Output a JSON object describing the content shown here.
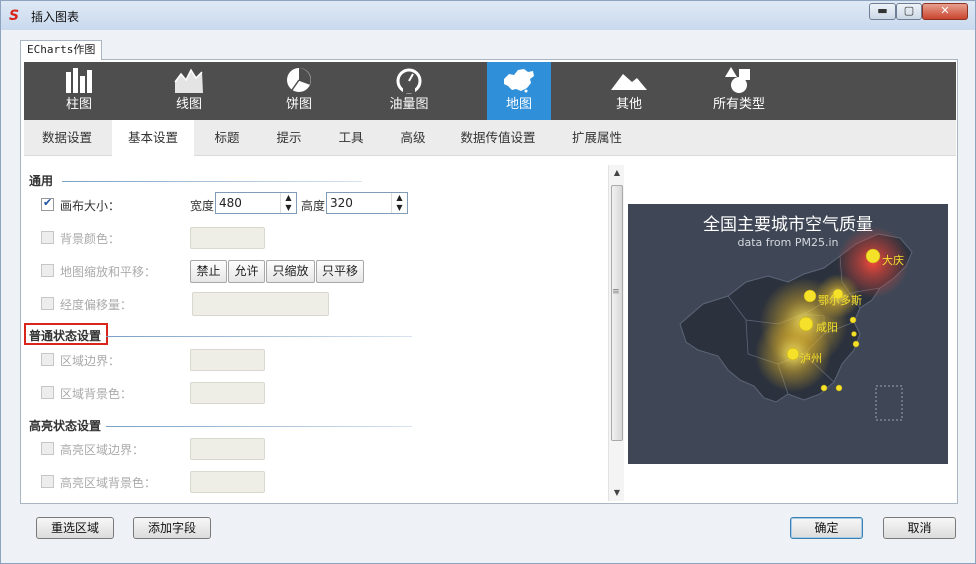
{
  "window": {
    "title": "插入图表",
    "app_icon": "S"
  },
  "tab": {
    "label": "ECharts作图"
  },
  "chart_types": [
    {
      "label": "柱图",
      "icon": "bar-chart-icon",
      "active": false
    },
    {
      "label": "线图",
      "icon": "line-chart-icon",
      "active": false
    },
    {
      "label": "饼图",
      "icon": "pie-chart-icon",
      "active": false
    },
    {
      "label": "油量图",
      "icon": "gauge-icon",
      "active": false
    },
    {
      "label": "地图",
      "icon": "china-map-icon",
      "active": true
    },
    {
      "label": "其他",
      "icon": "mountain-icon",
      "active": false
    },
    {
      "label": "所有类型",
      "icon": "shapes-icon",
      "active": false
    }
  ],
  "sub_tabs": [
    {
      "label": "数据设置",
      "active": false
    },
    {
      "label": "基本设置",
      "active": true
    },
    {
      "label": "标题",
      "active": false
    },
    {
      "label": "提示",
      "active": false
    },
    {
      "label": "工具",
      "active": false
    },
    {
      "label": "高级",
      "active": false
    },
    {
      "label": "数据传值设置",
      "active": false
    },
    {
      "label": "扩展属性",
      "active": false
    }
  ],
  "sections": {
    "general": {
      "title": "通用",
      "canvas_size": {
        "label": "画布大小：",
        "checked": true,
        "width_label": "宽度",
        "width_value": "480",
        "height_label": "高度",
        "height_value": "320"
      },
      "bg_color": {
        "label": "背景颜色："
      },
      "zoom_pan": {
        "label": "地图缩放和平移：",
        "options": [
          "禁止",
          "允许",
          "只缩放",
          "只平移"
        ]
      },
      "lon_offset": {
        "label": "经度偏移量："
      }
    },
    "normal_state": {
      "title": "普通状态设置",
      "region_border": {
        "label": "区域边界："
      },
      "region_bg": {
        "label": "区域背景色："
      }
    },
    "highlight_state": {
      "title": "高亮状态设置",
      "hl_border": {
        "label": "高亮区域边界："
      },
      "hl_bg": {
        "label": "高亮区域背景色："
      }
    }
  },
  "preview": {
    "title": "全国主要城市空气质量",
    "subtitle": "data from PM25.in",
    "cities": [
      "大庆",
      "鄂尔多斯",
      "咸阳",
      "泸州"
    ],
    "bg_color": "#3f4756",
    "point_color": "#f5e12a",
    "hotspot_color": "#e0453a"
  },
  "footer": {
    "reselect": "重选区域",
    "add_field": "添加字段",
    "ok": "确定",
    "cancel": "取消"
  },
  "colors": {
    "active_type": "#2f8fd8",
    "type_bar": "#4e4e4e",
    "highlight_border": "#d9261c"
  }
}
